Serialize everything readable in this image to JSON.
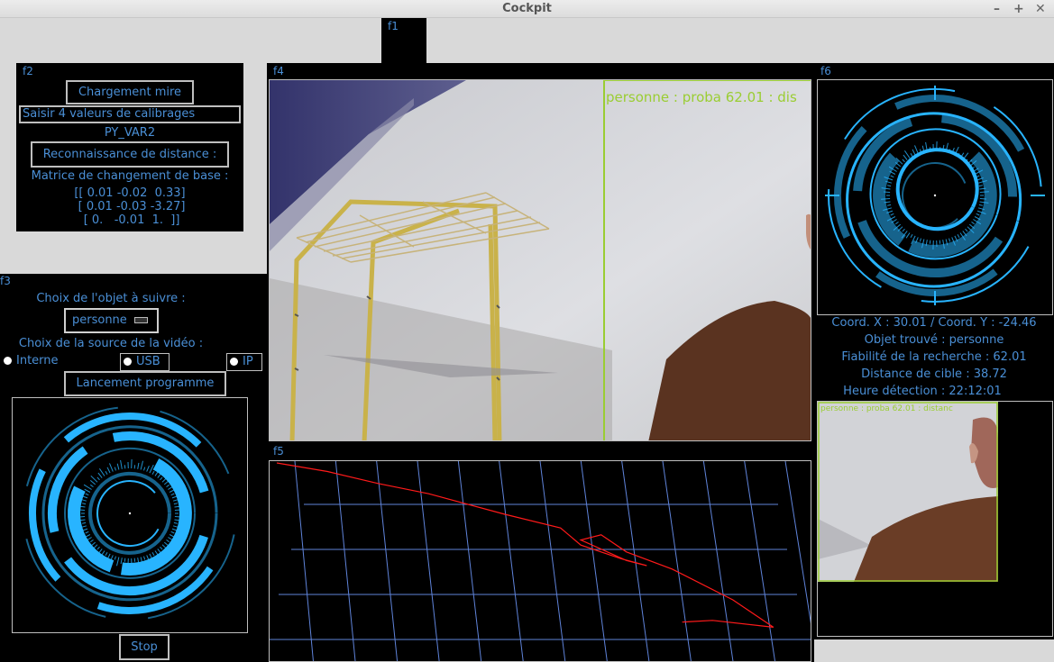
{
  "window": {
    "title": "Cockpit",
    "minimize": "–",
    "maximize": "+",
    "close": "✕"
  },
  "frames": {
    "f1": "f1",
    "f2": "f2",
    "f3": "f3",
    "f4": "f4",
    "f5": "f5",
    "f6": "f6"
  },
  "f2": {
    "load_target_button": "Chargement mire",
    "calibration_input_value": "Saisir 4 valeurs de calibrages",
    "var_label": "PY_VAR2",
    "distance_button": "Reconnaissance de distance :",
    "matrix_title": "Matrice de changement de base :",
    "matrix_rows": [
      "[[ 0.01 -0.02  0.33]",
      " [ 0.01 -0.03 -3.27]",
      " [ 0.   -0.01  1.  ]]"
    ]
  },
  "f3": {
    "object_label": "Choix de l'objet à suivre :",
    "object_selected": "personne",
    "source_label": "Choix de la source de la vidéo :",
    "sources": [
      "Interne",
      "USB",
      "IP"
    ],
    "launch_button": "Lancement programme",
    "stop_button": "Stop"
  },
  "f4": {
    "overlay_text": "personne : proba 62.01 : dis"
  },
  "f6": {
    "coords": "Coord. X : 30.01 / Coord. Y : -24.46",
    "object_found": "Objet trouvé : personne",
    "reliability": "Fiabilité de la recherche : 62.01",
    "distance": "Distance de cible : 38.72",
    "detection_time": "Heure détection : 22:12:01",
    "thumb_overlay": "personne : proba 62.01 : distanc"
  },
  "colors": {
    "accent": "#4a8fd6",
    "hud": "#28b4ff",
    "detect_box": "#9acd32",
    "trajectory": "#ff1a1a",
    "grid": "#5f83d9"
  },
  "trajectory": [
    [
      0,
      0
    ],
    [
      0.1,
      0.05
    ],
    [
      0.2,
      0.12
    ],
    [
      0.3,
      0.18
    ],
    [
      0.45,
      0.3
    ],
    [
      0.56,
      0.38
    ],
    [
      0.6,
      0.48
    ],
    [
      0.68,
      0.56
    ],
    [
      0.73,
      0.6
    ],
    [
      0.69,
      0.57
    ],
    [
      0.6,
      0.45
    ],
    [
      0.64,
      0.42
    ],
    [
      0.69,
      0.52
    ],
    [
      0.78,
      0.62
    ],
    [
      0.9,
      0.8
    ],
    [
      0.98,
      0.96
    ],
    [
      0.86,
      0.92
    ],
    [
      0.8,
      0.93
    ]
  ]
}
